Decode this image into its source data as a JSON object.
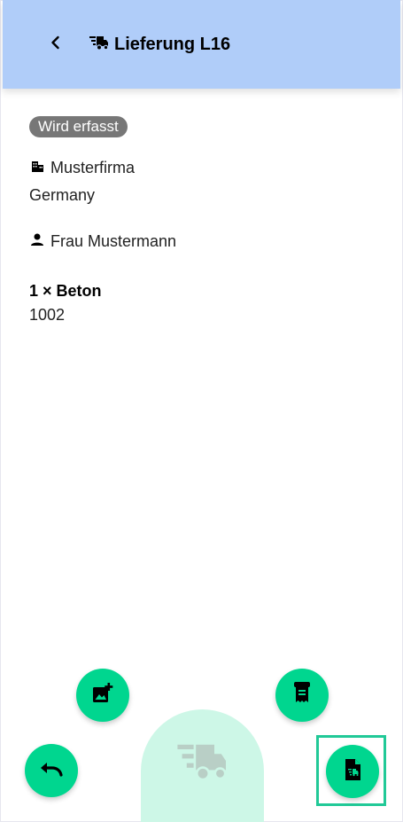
{
  "header": {
    "title": "Lieferung L16",
    "back_icon": "chevron-left-icon",
    "title_icon": "delivery-truck-icon"
  },
  "status": {
    "label": "Wird erfasst",
    "color": "#777777"
  },
  "customer": {
    "company": "Musterfirma",
    "country": "Germany",
    "contact": "Frau Mustermann"
  },
  "item": {
    "title": "1 × Beton",
    "number": "1002"
  },
  "actions": {
    "add_photo_icon": "add-photo-icon",
    "receipt_icon": "receipt-icon",
    "undo_icon": "undo-icon",
    "document_icon": "document-delivery-icon",
    "center_icon": "delivery-truck-icon"
  },
  "colors": {
    "appbar": "#b0cdf9",
    "accent": "#00d68f",
    "arch": "#cdf7e7",
    "highlight": "#21c997"
  }
}
